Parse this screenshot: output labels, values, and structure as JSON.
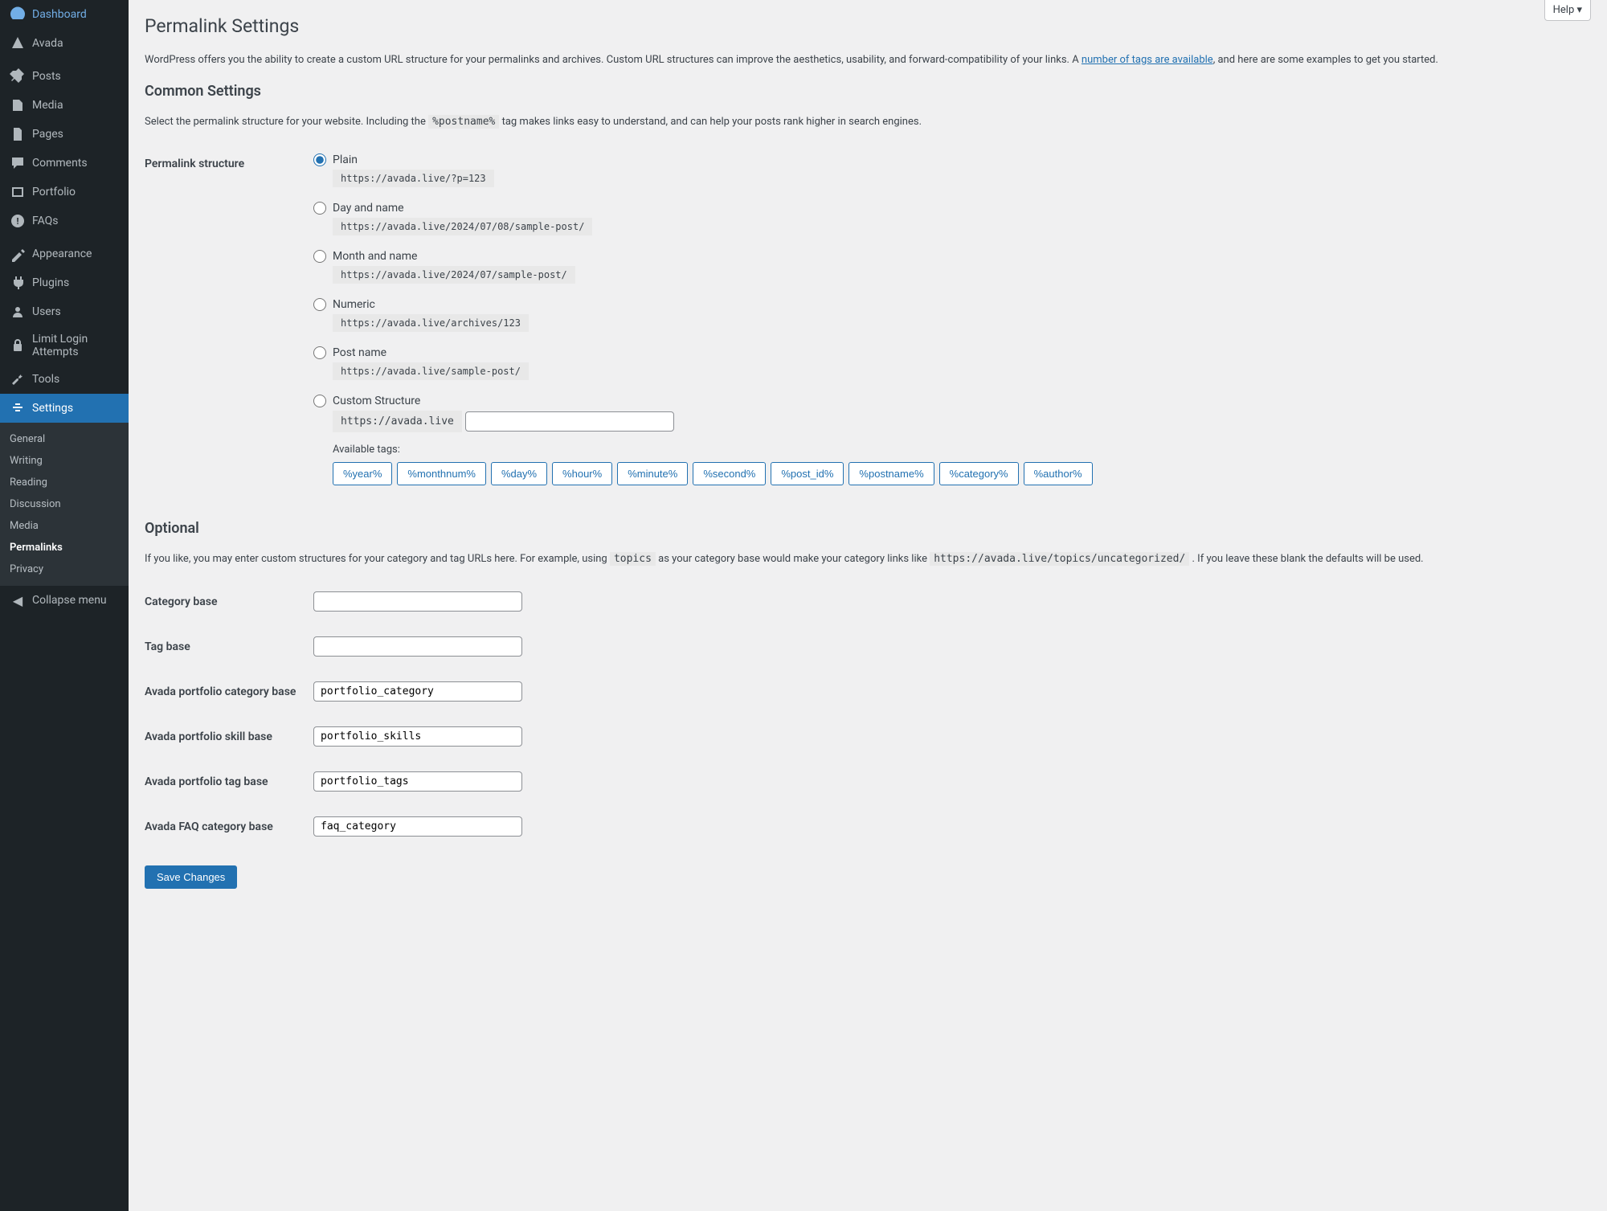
{
  "sidebar": {
    "items": [
      {
        "icon": "speedometer",
        "label": "Dashboard"
      },
      {
        "icon": "avada",
        "label": "Avada"
      },
      {
        "icon": null,
        "label": null
      },
      {
        "icon": "pushpin",
        "label": "Posts"
      },
      {
        "icon": "media",
        "label": "Media"
      },
      {
        "icon": "pages",
        "label": "Pages"
      },
      {
        "icon": "comment",
        "label": "Comments"
      },
      {
        "icon": "portfolio",
        "label": "Portfolio"
      },
      {
        "icon": "faq",
        "label": "FAQs"
      },
      {
        "icon": null,
        "label": null
      },
      {
        "icon": "appearance",
        "label": "Appearance"
      },
      {
        "icon": "plugins",
        "label": "Plugins"
      },
      {
        "icon": "users",
        "label": "Users"
      },
      {
        "icon": "limit",
        "label": "Limit Login Attempts"
      },
      {
        "icon": "tools",
        "label": "Tools"
      },
      {
        "icon": "settings",
        "label": "Settings",
        "active": true
      }
    ],
    "sub_items": [
      "General",
      "Writing",
      "Reading",
      "Discussion",
      "Media",
      "Permalinks",
      "Privacy"
    ],
    "sub_current": "Permalinks",
    "collapse_label": "Collapse menu"
  },
  "help_label": "Help ▾",
  "page_title": "Permalink Settings",
  "intro_text_before": "WordPress offers you the ability to create a custom URL structure for your permalinks and archives. Custom URL structures can improve the aesthetics, usability, and forward-compatibility of your links. A ",
  "intro_link": "number of tags are available",
  "intro_text_after": ", and here are some examples to get you started.",
  "common_heading": "Common Settings",
  "common_desc_before": "Select the permalink structure for your website. Including the ",
  "common_desc_code": "%postname%",
  "common_desc_after": " tag makes links easy to understand, and can help your posts rank higher in search engines.",
  "structure_label": "Permalink structure",
  "radios": [
    {
      "label": "Plain",
      "example": "https://avada.live/?p=123",
      "checked": true
    },
    {
      "label": "Day and name",
      "example": "https://avada.live/2024/07/08/sample-post/"
    },
    {
      "label": "Month and name",
      "example": "https://avada.live/2024/07/sample-post/"
    },
    {
      "label": "Numeric",
      "example": "https://avada.live/archives/123"
    },
    {
      "label": "Post name",
      "example": "https://avada.live/sample-post/"
    },
    {
      "label": "Custom Structure",
      "custom": true,
      "prefix": "https://avada.live"
    }
  ],
  "tags_label": "Available tags:",
  "tags": [
    "%year%",
    "%monthnum%",
    "%day%",
    "%hour%",
    "%minute%",
    "%second%",
    "%post_id%",
    "%postname%",
    "%category%",
    "%author%"
  ],
  "optional_heading": "Optional",
  "optional_text_before": "If you like, you may enter custom structures for your category and tag URLs here. For example, using ",
  "optional_code1": "topics",
  "optional_text_mid": " as your category base would make your category links like ",
  "optional_code2": "https://avada.live/topics/uncategorized/",
  "optional_text_after": " . If you leave these blank the defaults will be used.",
  "fields": [
    {
      "label": "Category base",
      "value": ""
    },
    {
      "label": "Tag base",
      "value": ""
    },
    {
      "label": "Avada portfolio category base",
      "value": "portfolio_category"
    },
    {
      "label": "Avada portfolio skill base",
      "value": "portfolio_skills"
    },
    {
      "label": "Avada portfolio tag base",
      "value": "portfolio_tags"
    },
    {
      "label": "Avada FAQ category base",
      "value": "faq_category"
    }
  ],
  "save_label": "Save Changes"
}
